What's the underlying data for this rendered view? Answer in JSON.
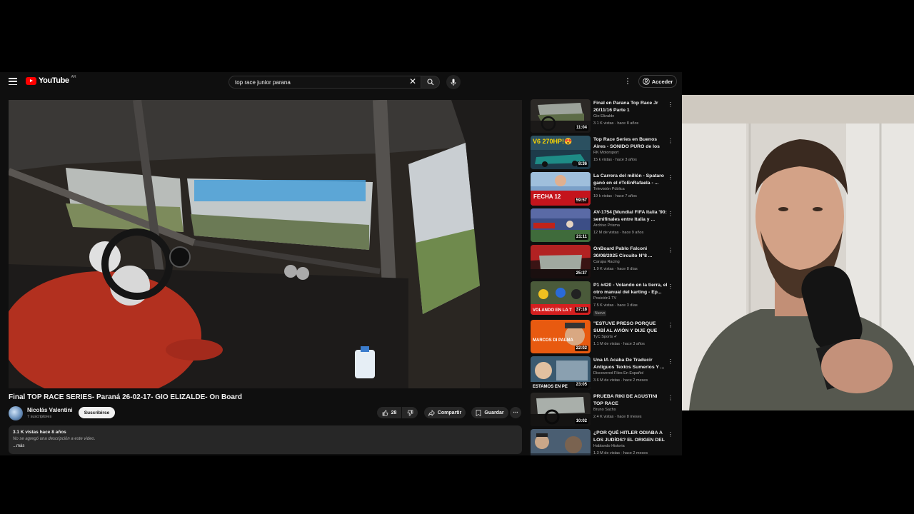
{
  "header": {
    "logo_text": "YouTube",
    "logo_sup": "AR",
    "search_value": "top race junior parana",
    "signin_label": "Acceder"
  },
  "video": {
    "title": "Final TOP RACE SERIES- Paraná 26-02-17- GIO ELIZALDE- On Board",
    "channel_name": "Nicolás Valentini",
    "channel_subs": "7 suscriptores",
    "subscribe_label": "Suscribirse",
    "like_count": "28",
    "share_label": "Compartir",
    "save_label": "Guardar",
    "desc_stats": "3.1 K vistas  hace 8 años",
    "desc_text": "No se agregó una descripción a este video.",
    "desc_more": "...más"
  },
  "recommendations": [
    {
      "title": "Final en Parana  Top Race Jr 20/11/16 Parte 1",
      "channel": "Gio Elizalde",
      "meta": "3.1 K vistas · hace 8 años",
      "duration": "11:04",
      "thumb": "cockpit"
    },
    {
      "title": "Top Race Series en Buenos Aires - SONIDO PURO de los V...",
      "channel": "RK Motorsport",
      "meta": "15 k vistas · hace 3 años",
      "duration": "8:36",
      "thumb": "v6",
      "thumb_text": "V6 270HP!😍"
    },
    {
      "title": "La Carrera del millón - Spataro ganó en el #TcEnRafaela - ...",
      "channel": "Televisión Pública",
      "meta": "19 k vistas · hace 7 años",
      "duration": "59:57",
      "thumb": "fecha",
      "thumb_text": "FECHA 12"
    },
    {
      "title": "AV-1754 [Mundial FIFA Italia '90: semifinales entre Italia y ...",
      "channel": "Archivo Prisma",
      "meta": "12 M de vistas · hace 9 años",
      "duration": "21:11",
      "thumb": "soccer"
    },
    {
      "title": "OnBoard Pablo Falconi 30/08/2025 Circuito N°8 ...",
      "channel": "Carupa Racing",
      "meta": "1.9 K vistas · hace 8 días",
      "duration": "25:37",
      "thumb": "redcar"
    },
    {
      "title": "P1 #420 -  Volando en la tierra, el otro manual del karting - Ep...",
      "channel": "Posición1 TV",
      "meta": "7.5 K vistas · hace 3 días",
      "duration": "37:18",
      "badge": "Nuevo",
      "thumb": "karting",
      "thumb_text": "VOLANDO EN LA T"
    },
    {
      "title": "\"ESTUVE PRESO PORQUE SUBÍ AL AVIÓN Y DIJE QUE TENÍA ...",
      "channel": "TyC Sports ✔",
      "meta": "1.1 M de vistas · hace 3 años",
      "duration": "22:02",
      "thumb": "palma",
      "thumb_text": "MARCOS DI PALMA"
    },
    {
      "title": "Una IA Acaba De Traducir Antiguos Textos Sumerios Y ...",
      "channel": "Discovered Files En Español",
      "meta": "3.6 M de vistas · hace 2 meses",
      "duration": "23:05",
      "thumb": "ia",
      "thumb_text": "ESTAMOS EN PE"
    },
    {
      "title": "PRUEBA RIKI DE AGUSTINI TOP RACE",
      "channel": "Bruno Sachs",
      "meta": "2.4 K vistas · hace 8 meses",
      "duration": "10:02",
      "thumb": "onboard2"
    },
    {
      "title": "¿POR QUÉ HITLER ODIABA A LOS JUDÍOS? EL ORIGEN DEL ...",
      "channel": "Hablando Historia",
      "meta": "1.3 M de vistas · hace 2 meses",
      "duration": "",
      "thumb": "history"
    }
  ]
}
